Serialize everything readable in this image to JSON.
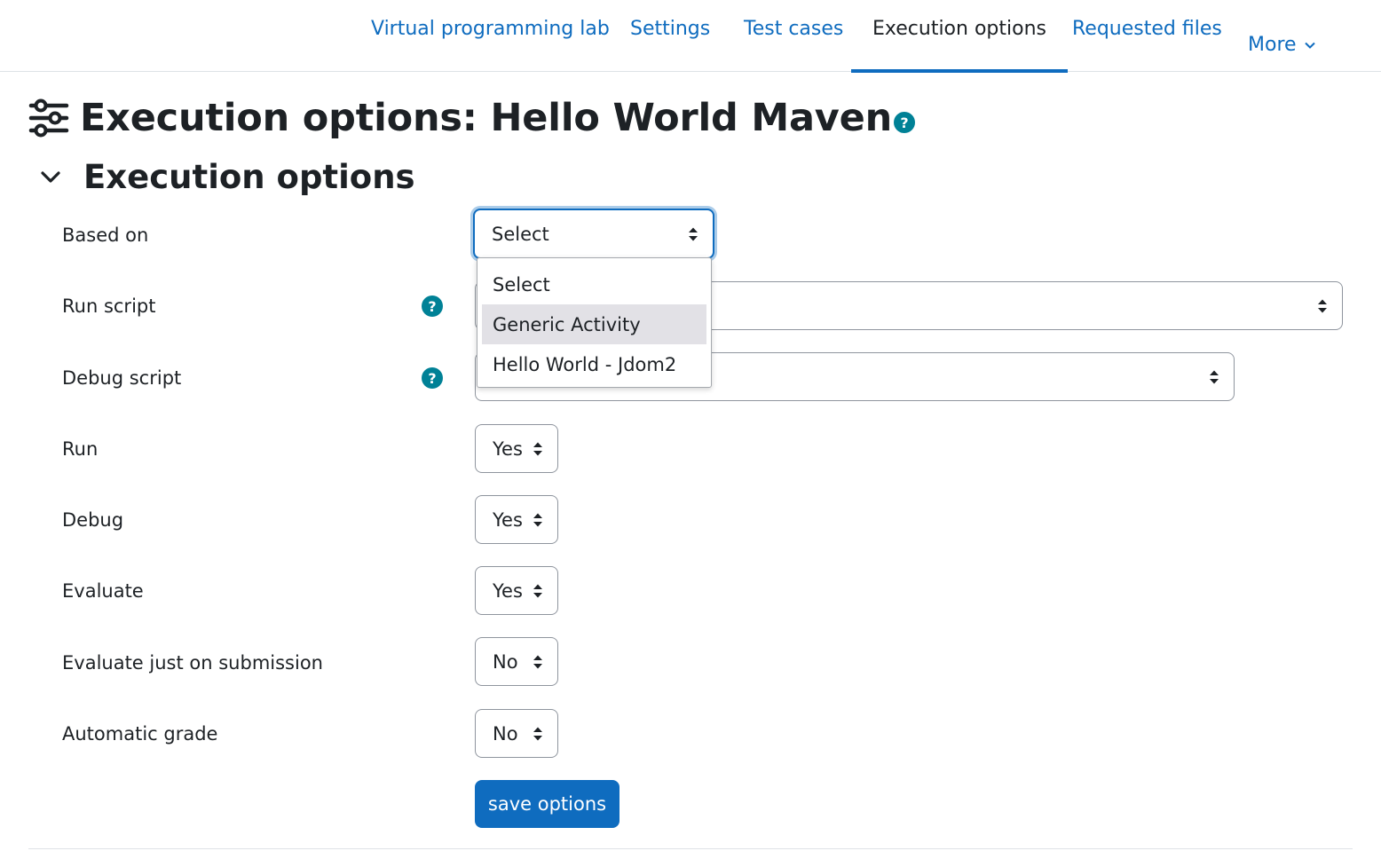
{
  "nav": {
    "tabs": [
      {
        "label": "Virtual programming lab"
      },
      {
        "label": "Settings"
      },
      {
        "label": "Test cases"
      },
      {
        "label": "Execution options",
        "active": true
      },
      {
        "label": "Requested files"
      },
      {
        "label": "More"
      }
    ]
  },
  "page": {
    "title": "Execution options: Hello World Maven",
    "section_title": "Execution options"
  },
  "form": {
    "based_on": {
      "label": "Based on",
      "value": "Select",
      "options": [
        "Select",
        "Generic Activity",
        "Hello World - Jdom2"
      ],
      "highlighted_option": "Generic Activity"
    },
    "run_script": {
      "label": "Run script",
      "value": ""
    },
    "debug_script": {
      "label": "Debug script",
      "value": ""
    },
    "run": {
      "label": "Run",
      "value": "Yes"
    },
    "debug": {
      "label": "Debug",
      "value": "Yes"
    },
    "evaluate": {
      "label": "Evaluate",
      "value": "Yes"
    },
    "evaluate_just_on_submission": {
      "label": "Evaluate just on submission",
      "value": "No"
    },
    "automatic_grade": {
      "label": "Automatic grade",
      "value": "No"
    },
    "help_icon_text": "?",
    "save_label": "save options"
  },
  "colors": {
    "link": "#0f6cbf",
    "help": "#008196",
    "text": "#1d2125",
    "highlight": "#e2e1e6"
  }
}
